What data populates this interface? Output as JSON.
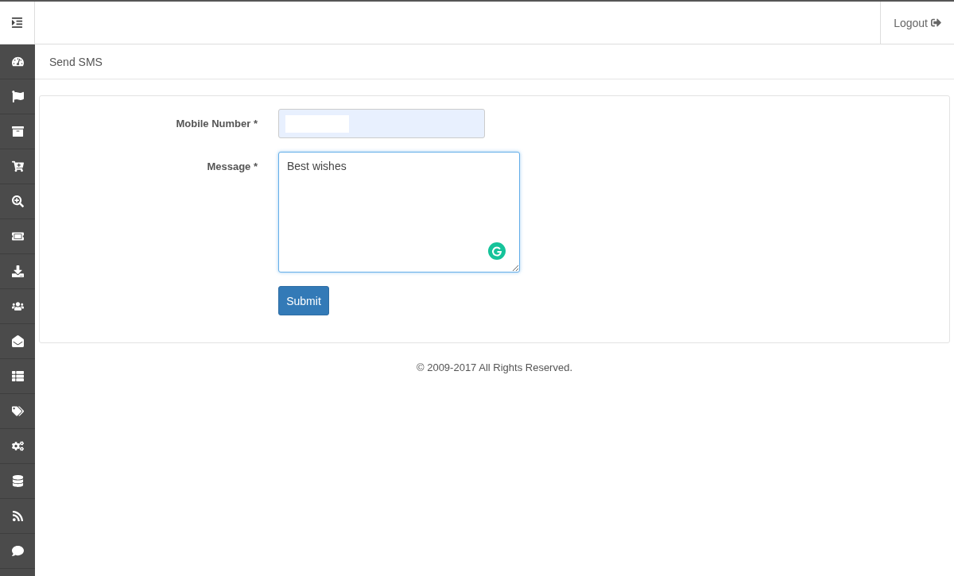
{
  "header": {
    "logout": "Logout"
  },
  "breadcrumb": {
    "title": "Send SMS"
  },
  "form": {
    "fields": [
      {
        "kind": "input",
        "label": "Mobile Number *"
      },
      {
        "kind": "textarea",
        "label": "Message *",
        "value": "Best wishes"
      }
    ],
    "submit": "Submit"
  },
  "footer": {
    "text": "© 2009-2017 All Rights Reserved."
  }
}
